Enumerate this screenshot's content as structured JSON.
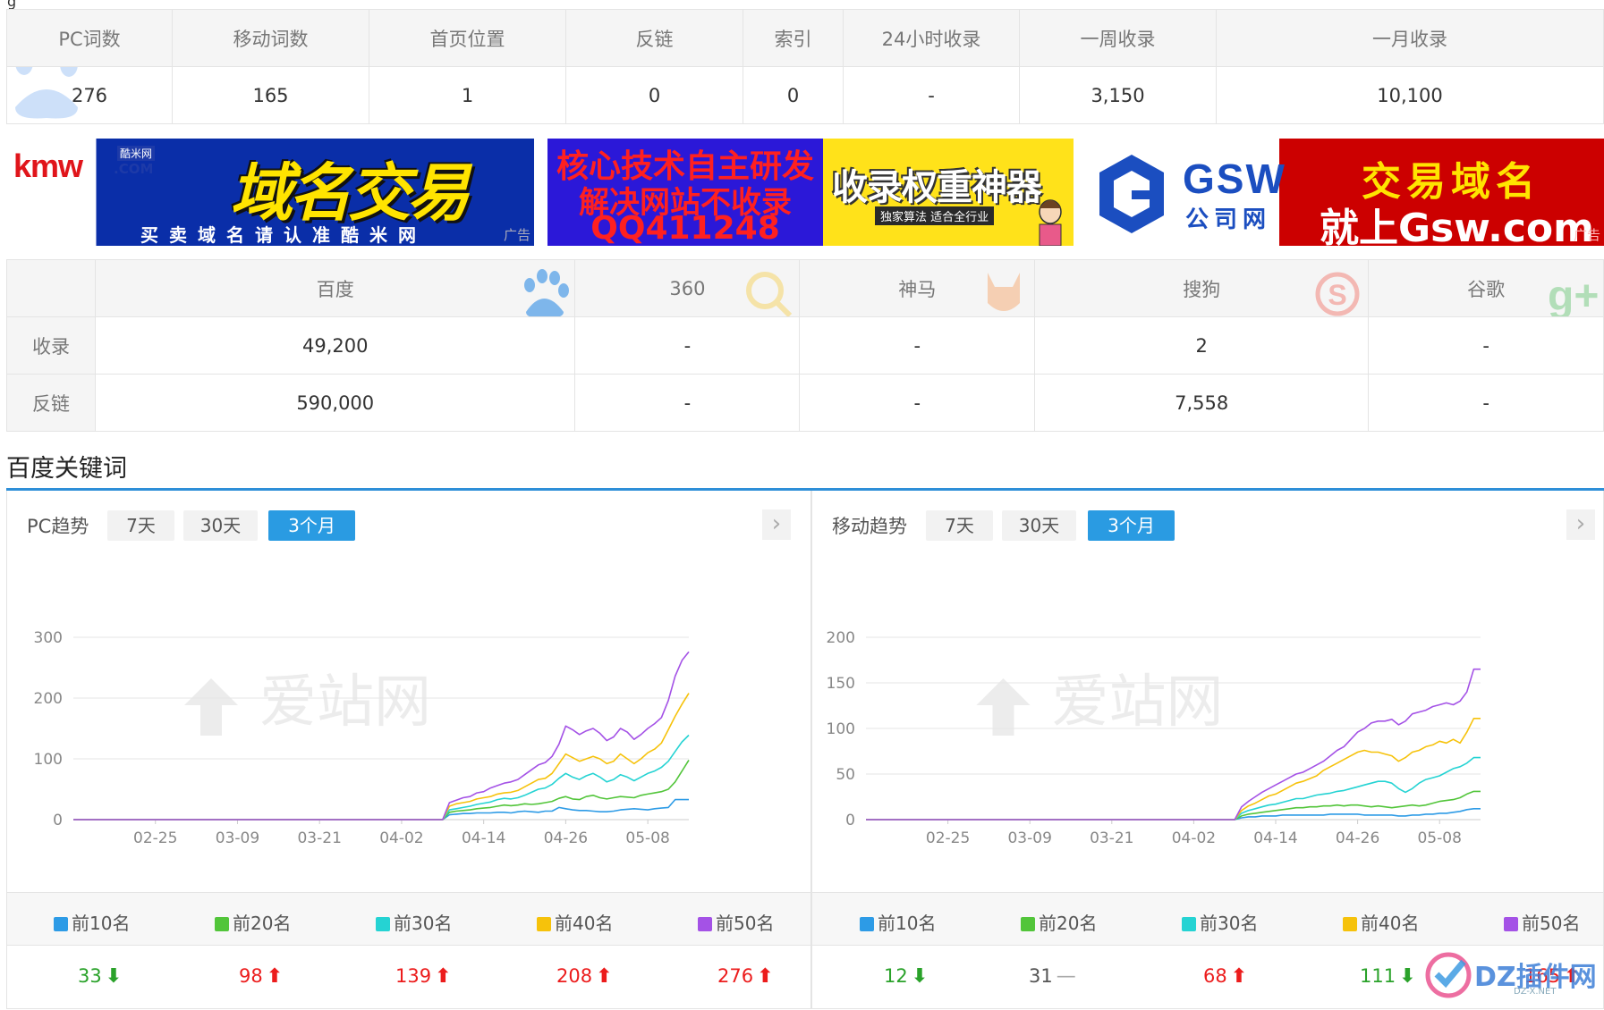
{
  "stats": {
    "headers": [
      "PC词数",
      "移动词数",
      "首页位置",
      "反链",
      "索引",
      "24小时收录",
      "一周收录",
      "一月收录"
    ],
    "values": [
      "276",
      "165",
      "1",
      "0",
      "0",
      "-",
      "3,150",
      "10,100"
    ]
  },
  "ads": {
    "kmw": {
      "logo_a": "kmw",
      "logo_b": "酷米网",
      "logo_com": ".COM",
      "headline": "域名交易",
      "sub": "买卖域名请认准酷米网",
      "label": "广告"
    },
    "seo": {
      "line1": "核心技术自主研发",
      "line2": "解决网站不收录",
      "line3": "QQ411248"
    },
    "tool": {
      "title": "收录权重神器",
      "tag": "独家算法 适合全行业"
    },
    "gsw": {
      "logo": "GSW",
      "logo_cn": "公司网",
      "line1": "交易域名",
      "line2": "就上Gsw.com",
      "label": "广告"
    }
  },
  "engines": {
    "headers": [
      "百度",
      "360",
      "神马",
      "搜狗",
      "谷歌"
    ],
    "rows": [
      {
        "label": "收录",
        "values": [
          "49,200",
          "-",
          "-",
          "2",
          "-"
        ]
      },
      {
        "label": "反链",
        "values": [
          "590,000",
          "-",
          "-",
          "7,558",
          "-"
        ]
      }
    ]
  },
  "section_title": "百度关键词",
  "watermark": "爱站网",
  "pc": {
    "title": "PC趋势",
    "tabs": [
      "7天",
      "30天",
      "3个月"
    ],
    "active_tab": "3个月",
    "counts": [
      {
        "value": "33",
        "dir": "down",
        "arrow": "⬇"
      },
      {
        "value": "98",
        "dir": "up",
        "arrow": "⬆"
      },
      {
        "value": "139",
        "dir": "up",
        "arrow": "⬆"
      },
      {
        "value": "208",
        "dir": "up",
        "arrow": "⬆"
      },
      {
        "value": "276",
        "dir": "up",
        "arrow": "⬆"
      }
    ]
  },
  "mobile": {
    "title": "移动趋势",
    "tabs": [
      "7天",
      "30天",
      "3个月"
    ],
    "active_tab": "3个月",
    "counts": [
      {
        "value": "12",
        "dir": "down",
        "arrow": "⬇"
      },
      {
        "value": "31",
        "dir": "flat",
        "arrow": "—"
      },
      {
        "value": "68",
        "dir": "up",
        "arrow": "⬆"
      },
      {
        "value": "111",
        "dir": "down",
        "arrow": "⬇"
      },
      {
        "value": "165",
        "dir": "up",
        "arrow": "⬆"
      }
    ]
  },
  "legend": [
    {
      "label": "前10名",
      "color": "#2d9be6"
    },
    {
      "label": "前20名",
      "color": "#52c53a"
    },
    {
      "label": "前30名",
      "color": "#25d3d3"
    },
    {
      "label": "前40名",
      "color": "#f6c20b"
    },
    {
      "label": "前50名",
      "color": "#a452e6"
    }
  ],
  "brand": {
    "name": "DZ插件网",
    "sub": "DZ-X.NET"
  },
  "chart_data": [
    {
      "type": "line",
      "title": "PC趋势",
      "x_ticks": [
        "02-25",
        "03-09",
        "03-21",
        "04-02",
        "04-14",
        "04-26",
        "05-08"
      ],
      "y_ticks": [
        0,
        100,
        200,
        300
      ],
      "ylim": [
        0,
        300
      ],
      "x_days": 90,
      "x_start_index": 12,
      "x_tick_step": 12,
      "series": [
        {
          "name": "前10名",
          "color": "#2d9be6",
          "values": [
            0,
            0,
            0,
            0,
            0,
            0,
            0,
            0,
            0,
            0,
            0,
            0,
            0,
            0,
            0,
            0,
            0,
            0,
            0,
            0,
            0,
            0,
            0,
            0,
            0,
            0,
            0,
            0,
            0,
            0,
            0,
            0,
            0,
            0,
            0,
            0,
            0,
            0,
            0,
            0,
            0,
            0,
            0,
            0,
            0,
            0,
            0,
            0,
            0,
            0,
            0,
            0,
            0,
            0,
            0,
            8,
            9,
            10,
            10,
            11,
            11,
            11,
            12,
            12,
            11,
            13,
            14,
            13,
            12,
            14,
            14,
            20,
            18,
            16,
            15,
            15,
            14,
            13,
            13,
            14,
            16,
            17,
            18,
            17,
            16,
            18,
            19,
            20,
            33,
            33,
            33
          ]
        },
        {
          "name": "前20名",
          "color": "#52c53a",
          "values": [
            0,
            0,
            0,
            0,
            0,
            0,
            0,
            0,
            0,
            0,
            0,
            0,
            0,
            0,
            0,
            0,
            0,
            0,
            0,
            0,
            0,
            0,
            0,
            0,
            0,
            0,
            0,
            0,
            0,
            0,
            0,
            0,
            0,
            0,
            0,
            0,
            0,
            0,
            0,
            0,
            0,
            0,
            0,
            0,
            0,
            0,
            0,
            0,
            0,
            0,
            0,
            0,
            0,
            0,
            0,
            12,
            14,
            15,
            16,
            18,
            19,
            20,
            22,
            24,
            23,
            24,
            26,
            25,
            26,
            28,
            30,
            35,
            38,
            34,
            33,
            38,
            40,
            36,
            34,
            36,
            38,
            37,
            36,
            40,
            42,
            44,
            46,
            50,
            62,
            80,
            98
          ]
        },
        {
          "name": "前30名",
          "color": "#25d3d3",
          "values": [
            0,
            0,
            0,
            0,
            0,
            0,
            0,
            0,
            0,
            0,
            0,
            0,
            0,
            0,
            0,
            0,
            0,
            0,
            0,
            0,
            0,
            0,
            0,
            0,
            0,
            0,
            0,
            0,
            0,
            0,
            0,
            0,
            0,
            0,
            0,
            0,
            0,
            0,
            0,
            0,
            0,
            0,
            0,
            0,
            0,
            0,
            0,
            0,
            0,
            0,
            0,
            0,
            0,
            0,
            0,
            16,
            18,
            20,
            22,
            25,
            27,
            29,
            33,
            35,
            34,
            36,
            40,
            45,
            50,
            52,
            58,
            68,
            76,
            70,
            66,
            72,
            76,
            70,
            62,
            66,
            74,
            70,
            64,
            70,
            76,
            80,
            86,
            96,
            112,
            128,
            139
          ]
        },
        {
          "name": "前40名",
          "color": "#f6c20b",
          "values": [
            0,
            0,
            0,
            0,
            0,
            0,
            0,
            0,
            0,
            0,
            0,
            0,
            0,
            0,
            0,
            0,
            0,
            0,
            0,
            0,
            0,
            0,
            0,
            0,
            0,
            0,
            0,
            0,
            0,
            0,
            0,
            0,
            0,
            0,
            0,
            0,
            0,
            0,
            0,
            0,
            0,
            0,
            0,
            0,
            0,
            0,
            0,
            0,
            0,
            0,
            0,
            0,
            0,
            0,
            0,
            22,
            26,
            28,
            30,
            34,
            36,
            38,
            42,
            44,
            45,
            48,
            54,
            60,
            66,
            68,
            76,
            92,
            108,
            102,
            96,
            100,
            104,
            100,
            92,
            96,
            108,
            100,
            92,
            100,
            110,
            116,
            126,
            148,
            170,
            190,
            208
          ]
        },
        {
          "name": "前50名",
          "color": "#a452e6",
          "values": [
            0,
            0,
            0,
            0,
            0,
            0,
            0,
            0,
            0,
            0,
            0,
            0,
            0,
            0,
            0,
            0,
            0,
            0,
            0,
            0,
            0,
            0,
            0,
            0,
            0,
            0,
            0,
            0,
            0,
            0,
            0,
            0,
            0,
            0,
            0,
            0,
            0,
            0,
            0,
            0,
            0,
            0,
            0,
            0,
            0,
            0,
            0,
            0,
            0,
            0,
            0,
            0,
            0,
            0,
            0,
            28,
            32,
            36,
            38,
            44,
            46,
            52,
            56,
            60,
            62,
            66,
            74,
            82,
            90,
            94,
            104,
            124,
            154,
            148,
            140,
            146,
            150,
            142,
            130,
            136,
            150,
            144,
            132,
            140,
            150,
            158,
            168,
            196,
            236,
            262,
            276
          ]
        }
      ]
    },
    {
      "type": "line",
      "title": "移动趋势",
      "x_ticks": [
        "02-25",
        "03-09",
        "03-21",
        "04-02",
        "04-14",
        "04-26",
        "05-08"
      ],
      "y_ticks": [
        0,
        50,
        100,
        150,
        200
      ],
      "ylim": [
        0,
        200
      ],
      "x_days": 90,
      "x_start_index": 12,
      "x_tick_step": 12,
      "series": [
        {
          "name": "前10名",
          "color": "#2d9be6",
          "values": [
            0,
            0,
            0,
            0,
            0,
            0,
            0,
            0,
            0,
            0,
            0,
            0,
            0,
            0,
            0,
            0,
            0,
            0,
            0,
            0,
            0,
            0,
            0,
            0,
            0,
            0,
            0,
            0,
            0,
            0,
            0,
            0,
            0,
            0,
            0,
            0,
            0,
            0,
            0,
            0,
            0,
            0,
            0,
            0,
            0,
            0,
            0,
            0,
            0,
            0,
            0,
            0,
            0,
            0,
            0,
            2,
            3,
            3,
            4,
            4,
            4,
            5,
            5,
            5,
            5,
            5,
            5,
            5,
            6,
            6,
            6,
            6,
            6,
            5,
            5,
            5,
            5,
            5,
            4,
            4,
            5,
            5,
            6,
            6,
            7,
            7,
            8,
            9,
            11,
            12,
            12
          ]
        },
        {
          "name": "前20名",
          "color": "#52c53a",
          "values": [
            0,
            0,
            0,
            0,
            0,
            0,
            0,
            0,
            0,
            0,
            0,
            0,
            0,
            0,
            0,
            0,
            0,
            0,
            0,
            0,
            0,
            0,
            0,
            0,
            0,
            0,
            0,
            0,
            0,
            0,
            0,
            0,
            0,
            0,
            0,
            0,
            0,
            0,
            0,
            0,
            0,
            0,
            0,
            0,
            0,
            0,
            0,
            0,
            0,
            0,
            0,
            0,
            0,
            0,
            0,
            4,
            6,
            7,
            8,
            9,
            10,
            11,
            12,
            13,
            13,
            14,
            14,
            15,
            15,
            16,
            15,
            16,
            16,
            15,
            14,
            15,
            14,
            13,
            14,
            15,
            16,
            15,
            16,
            18,
            20,
            21,
            22,
            24,
            28,
            31,
            31
          ]
        },
        {
          "name": "前30名",
          "color": "#25d3d3",
          "values": [
            0,
            0,
            0,
            0,
            0,
            0,
            0,
            0,
            0,
            0,
            0,
            0,
            0,
            0,
            0,
            0,
            0,
            0,
            0,
            0,
            0,
            0,
            0,
            0,
            0,
            0,
            0,
            0,
            0,
            0,
            0,
            0,
            0,
            0,
            0,
            0,
            0,
            0,
            0,
            0,
            0,
            0,
            0,
            0,
            0,
            0,
            0,
            0,
            0,
            0,
            0,
            0,
            0,
            0,
            0,
            7,
            10,
            12,
            14,
            16,
            17,
            19,
            21,
            23,
            23,
            25,
            27,
            28,
            29,
            31,
            32,
            34,
            36,
            38,
            40,
            42,
            42,
            40,
            34,
            30,
            34,
            40,
            44,
            46,
            48,
            52,
            56,
            58,
            62,
            68,
            68
          ]
        },
        {
          "name": "前40名",
          "color": "#f6c20b",
          "values": [
            0,
            0,
            0,
            0,
            0,
            0,
            0,
            0,
            0,
            0,
            0,
            0,
            0,
            0,
            0,
            0,
            0,
            0,
            0,
            0,
            0,
            0,
            0,
            0,
            0,
            0,
            0,
            0,
            0,
            0,
            0,
            0,
            0,
            0,
            0,
            0,
            0,
            0,
            0,
            0,
            0,
            0,
            0,
            0,
            0,
            0,
            0,
            0,
            0,
            0,
            0,
            0,
            0,
            0,
            0,
            10,
            15,
            18,
            22,
            26,
            28,
            32,
            36,
            40,
            42,
            45,
            48,
            54,
            58,
            62,
            66,
            70,
            74,
            76,
            74,
            74,
            72,
            70,
            64,
            68,
            74,
            76,
            80,
            82,
            86,
            84,
            88,
            84,
            96,
            111,
            111
          ]
        },
        {
          "name": "前50名",
          "color": "#a452e6",
          "values": [
            0,
            0,
            0,
            0,
            0,
            0,
            0,
            0,
            0,
            0,
            0,
            0,
            0,
            0,
            0,
            0,
            0,
            0,
            0,
            0,
            0,
            0,
            0,
            0,
            0,
            0,
            0,
            0,
            0,
            0,
            0,
            0,
            0,
            0,
            0,
            0,
            0,
            0,
            0,
            0,
            0,
            0,
            0,
            0,
            0,
            0,
            0,
            0,
            0,
            0,
            0,
            0,
            0,
            0,
            0,
            14,
            20,
            25,
            30,
            34,
            38,
            42,
            46,
            50,
            52,
            56,
            60,
            64,
            70,
            76,
            80,
            88,
            96,
            100,
            106,
            108,
            108,
            110,
            104,
            108,
            116,
            118,
            120,
            124,
            126,
            128,
            126,
            130,
            140,
            165,
            165
          ]
        }
      ]
    }
  ]
}
